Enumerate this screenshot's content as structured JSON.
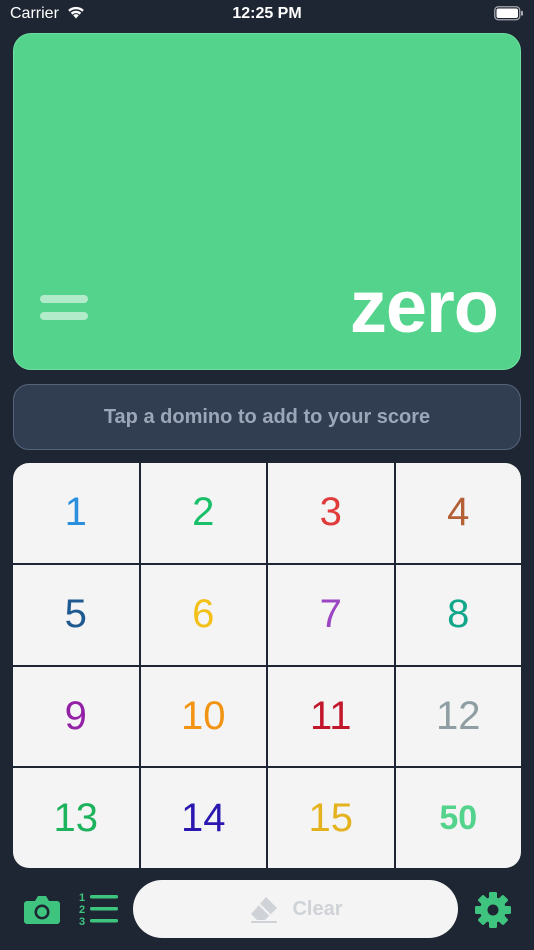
{
  "status_bar": {
    "carrier": "Carrier",
    "time": "12:25 PM"
  },
  "score": {
    "value_text": "zero",
    "card_color": "#53d38b"
  },
  "hint": {
    "text": "Tap a domino to add to your score"
  },
  "keypad": {
    "keys": [
      {
        "label": "1",
        "color": "#2a8fdc"
      },
      {
        "label": "2",
        "color": "#19c06a"
      },
      {
        "label": "3",
        "color": "#e03a3a"
      },
      {
        "label": "4",
        "color": "#b45f35"
      },
      {
        "label": "5",
        "color": "#1e5a8f"
      },
      {
        "label": "6",
        "color": "#f2c017"
      },
      {
        "label": "7",
        "color": "#9b45c2"
      },
      {
        "label": "8",
        "color": "#12a68a"
      },
      {
        "label": "9",
        "color": "#9321a5"
      },
      {
        "label": "10",
        "color": "#f39312"
      },
      {
        "label": "11",
        "color": "#c2162a"
      },
      {
        "label": "12",
        "color": "#8f9ea3"
      },
      {
        "label": "13",
        "color": "#1cb35c"
      },
      {
        "label": "14",
        "color": "#2a17b0"
      },
      {
        "label": "15",
        "color": "#e4b21d"
      },
      {
        "label": "50",
        "color": "#53d38b"
      }
    ]
  },
  "bottom_bar": {
    "clear_label": "Clear",
    "accent_color": "#3fc480",
    "icons": [
      "camera-icon",
      "numbered-list-icon",
      "eraser-icon",
      "gear-icon"
    ]
  }
}
